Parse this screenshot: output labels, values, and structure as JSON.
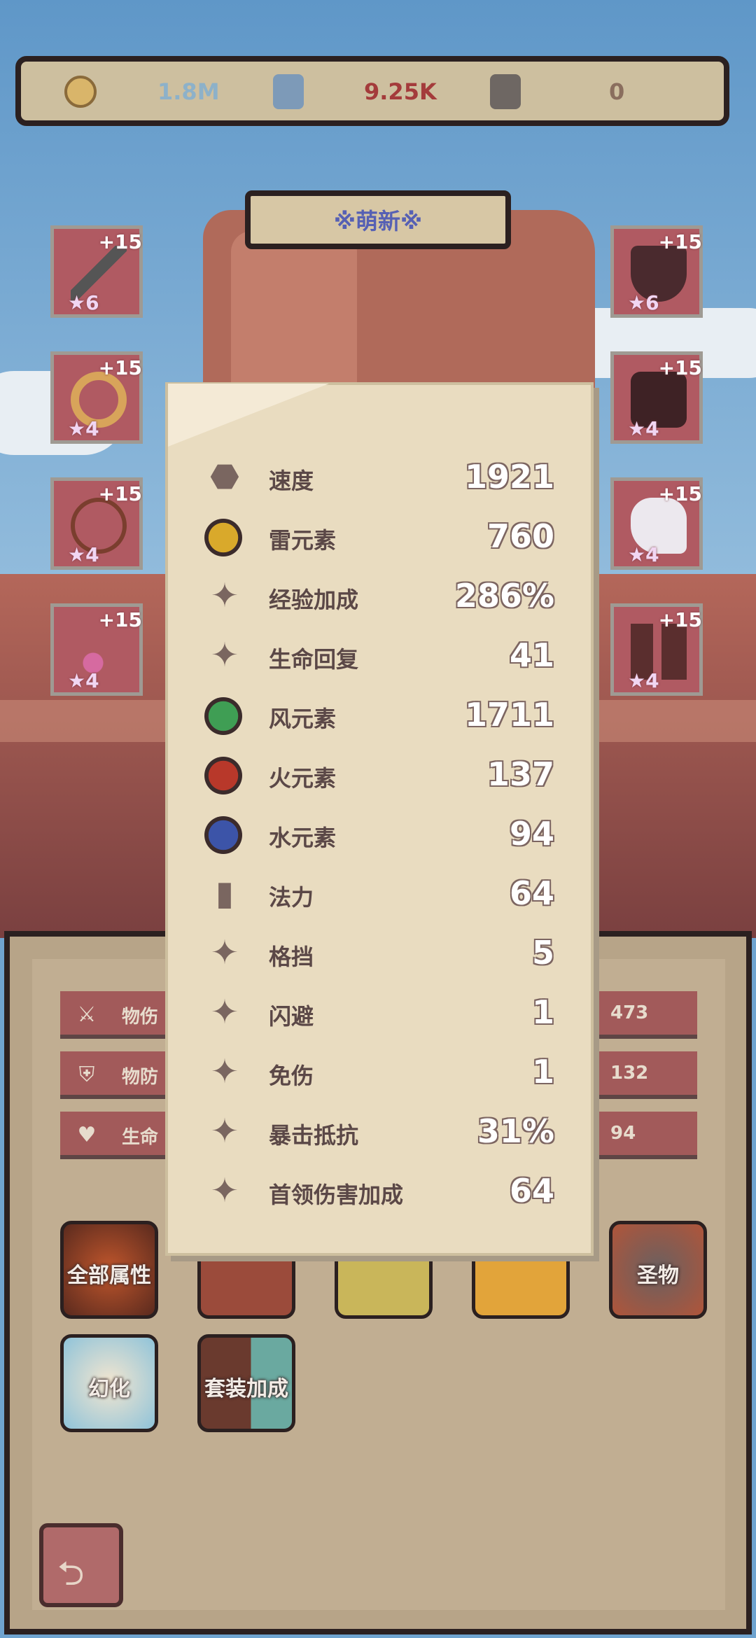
{
  "currencies": [
    {
      "icon": "gold-coin-icon",
      "value": "1.8M",
      "color": "#8db1c9"
    },
    {
      "icon": "blue-rune-icon",
      "value": "9.25K",
      "color": "#a43b3b"
    },
    {
      "icon": "grey-rune-icon",
      "value": "0",
      "color": "#8a6e5e"
    }
  ],
  "title": "※萌新※",
  "equipment_left": [
    {
      "icon": "sword-icon",
      "level": "+15",
      "stars": "★6"
    },
    {
      "icon": "ring-icon",
      "level": "+15",
      "stars": "★4"
    },
    {
      "icon": "amulet-icon",
      "level": "+15",
      "stars": "★4"
    },
    {
      "icon": "earring-icon",
      "level": "+15",
      "stars": "★4"
    }
  ],
  "equipment_right": [
    {
      "icon": "hat-icon",
      "level": "+15",
      "stars": "★6"
    },
    {
      "icon": "coat-icon",
      "level": "+15",
      "stars": "★4"
    },
    {
      "icon": "glove-icon",
      "level": "+15",
      "stars": "★4"
    },
    {
      "icon": "boots-icon",
      "level": "+15",
      "stars": "★4"
    }
  ],
  "base_stats": [
    {
      "icon": "sword-icon",
      "label": "物伤",
      "value": "473"
    },
    {
      "icon": "shield-icon",
      "label": "物防",
      "value": "132"
    },
    {
      "icon": "heart-icon",
      "label": "生命",
      "value": "94"
    }
  ],
  "buttons": {
    "all_attributes": "全部属性",
    "artifact": "圣物",
    "illusion": "幻化",
    "set_bonus": "套装加成"
  },
  "attributes": [
    {
      "icon": "boot-icon",
      "name": "速度",
      "value": "1921",
      "color": "#7a6660"
    },
    {
      "icon": "thunder-icon",
      "name": "雷元素",
      "value": "760",
      "color": "#d9a92b"
    },
    {
      "icon": "sparkle-icon",
      "name": "经验加成",
      "value": "286%",
      "color": "#7a6660"
    },
    {
      "icon": "sparkle-icon",
      "name": "生命回复",
      "value": "41",
      "color": "#7a6660"
    },
    {
      "icon": "wind-icon",
      "name": "风元素",
      "value": "1711",
      "color": "#3f9e54"
    },
    {
      "icon": "fire-icon",
      "name": "火元素",
      "value": "137",
      "color": "#b8382a"
    },
    {
      "icon": "water-icon",
      "name": "水元素",
      "value": "94",
      "color": "#3c54a8"
    },
    {
      "icon": "book-icon",
      "name": "法力",
      "value": "64",
      "color": "#7a6660"
    },
    {
      "icon": "sparkle-icon",
      "name": "格挡",
      "value": "5",
      "color": "#7a6660"
    },
    {
      "icon": "sparkle-icon",
      "name": "闪避",
      "value": "1",
      "color": "#7a6660"
    },
    {
      "icon": "sparkle-icon",
      "name": "免伤",
      "value": "1",
      "color": "#7a6660"
    },
    {
      "icon": "sparkle-icon",
      "name": "暴击抵抗",
      "value": "31%",
      "color": "#7a6660"
    },
    {
      "icon": "sparkle-icon",
      "name": "首领伤害加成",
      "value": "64",
      "color": "#7a6660"
    }
  ]
}
